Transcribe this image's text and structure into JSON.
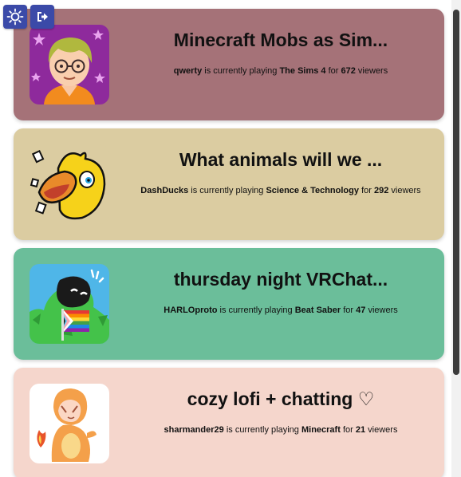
{
  "header": {
    "theme_icon": "sun-icon",
    "logout_icon": "logout-icon",
    "button_color": "#3b4aa8"
  },
  "streams": [
    {
      "title": "Minecraft Mobs as Sim...",
      "streamer": "qwerty",
      "playing_text": "is currently playing",
      "game": "The Sims 4",
      "for_text": "for",
      "viewers": "672",
      "viewers_text": "viewers",
      "bg": "#a57278",
      "avatar": "nerd-character-avatar"
    },
    {
      "title": "What animals will we ...",
      "streamer": "DashDucks",
      "playing_text": "is currently playing",
      "game": "Science & Technology",
      "for_text": "for",
      "viewers": "292",
      "viewers_text": "viewers",
      "bg": "#dbcca1",
      "avatar": "duck-avatar"
    },
    {
      "title": "thursday night VRChat...",
      "streamer": "HARLOproto",
      "playing_text": "is currently playing",
      "game": "Beat Saber",
      "for_text": "for",
      "viewers": "47",
      "viewers_text": "viewers",
      "bg": "#6bbe9a",
      "avatar": "protogen-avatar"
    },
    {
      "title": "cozy lofi + chatting ♡",
      "streamer": "sharmander29",
      "playing_text": "is currently playing",
      "game": "Minecraft",
      "for_text": "for",
      "viewers": "21",
      "viewers_text": "viewers",
      "bg": "#f5d6cc",
      "avatar": "charmander-costume-avatar"
    }
  ]
}
